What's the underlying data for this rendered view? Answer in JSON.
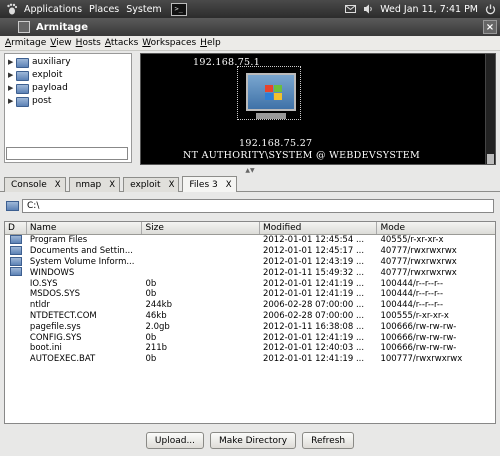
{
  "panel": {
    "menus": [
      "Applications",
      "Places",
      "System"
    ],
    "datetime": "Wed Jan 11,  7:41 PM"
  },
  "window": {
    "title": "Armitage"
  },
  "menubar": [
    "Armitage",
    "View",
    "Hosts",
    "Attacks",
    "Workspaces",
    "Help"
  ],
  "modules": [
    "auxiliary",
    "exploit",
    "payload",
    "post"
  ],
  "graph": {
    "attacker_ip": "192.168.75.1",
    "target_ip": "192.168.75.27",
    "target_label": "NT AUTHORITY\\SYSTEM @ WEBDEVSYSTEM"
  },
  "tabs": [
    {
      "label": "Console",
      "close": "X"
    },
    {
      "label": "nmap",
      "close": "X"
    },
    {
      "label": "exploit",
      "close": "X"
    },
    {
      "label": "Files 3",
      "close": "X"
    }
  ],
  "path": "C:\\",
  "table": {
    "headers": [
      "D",
      "Name",
      "Size",
      "Modified",
      "Mode"
    ],
    "rows": [
      {
        "dir": true,
        "name": "Program Files",
        "size": "",
        "modified": "2012-01-01 12:45:54 ...",
        "mode": "40555/r-xr-xr-x"
      },
      {
        "dir": true,
        "name": "Documents and Settin...",
        "size": "",
        "modified": "2012-01-01 12:45:17 ...",
        "mode": "40777/rwxrwxrwx"
      },
      {
        "dir": true,
        "name": "System Volume Inform...",
        "size": "",
        "modified": "2012-01-01 12:43:19 ...",
        "mode": "40777/rwxrwxrwx"
      },
      {
        "dir": true,
        "name": "WINDOWS",
        "size": "",
        "modified": "2012-01-11 15:49:32 ...",
        "mode": "40777/rwxrwxrwx"
      },
      {
        "dir": false,
        "name": "IO.SYS",
        "size": "0b",
        "modified": "2012-01-01 12:41:19 ...",
        "mode": "100444/r--r--r--"
      },
      {
        "dir": false,
        "name": "MSDOS.SYS",
        "size": "0b",
        "modified": "2012-01-01 12:41:19 ...",
        "mode": "100444/r--r--r--"
      },
      {
        "dir": false,
        "name": "ntldr",
        "size": "244kb",
        "modified": "2006-02-28 07:00:00 ...",
        "mode": "100444/r--r--r--"
      },
      {
        "dir": false,
        "name": "NTDETECT.COM",
        "size": "46kb",
        "modified": "2006-02-28 07:00:00 ...",
        "mode": "100555/r-xr-xr-x"
      },
      {
        "dir": false,
        "name": "pagefile.sys",
        "size": "2.0gb",
        "modified": "2012-01-11 16:38:08 ...",
        "mode": "100666/rw-rw-rw-"
      },
      {
        "dir": false,
        "name": "CONFIG.SYS",
        "size": "0b",
        "modified": "2012-01-01 12:41:19 ...",
        "mode": "100666/rw-rw-rw-"
      },
      {
        "dir": false,
        "name": "boot.ini",
        "size": "211b",
        "modified": "2012-01-01 12:40:03 ...",
        "mode": "100666/rw-rw-rw-"
      },
      {
        "dir": false,
        "name": "AUTOEXEC.BAT",
        "size": "0b",
        "modified": "2012-01-01 12:41:19 ...",
        "mode": "100777/rwxrwxrwx"
      }
    ]
  },
  "buttons": {
    "upload": "Upload...",
    "make_directory": "Make Directory",
    "refresh": "Refresh"
  }
}
